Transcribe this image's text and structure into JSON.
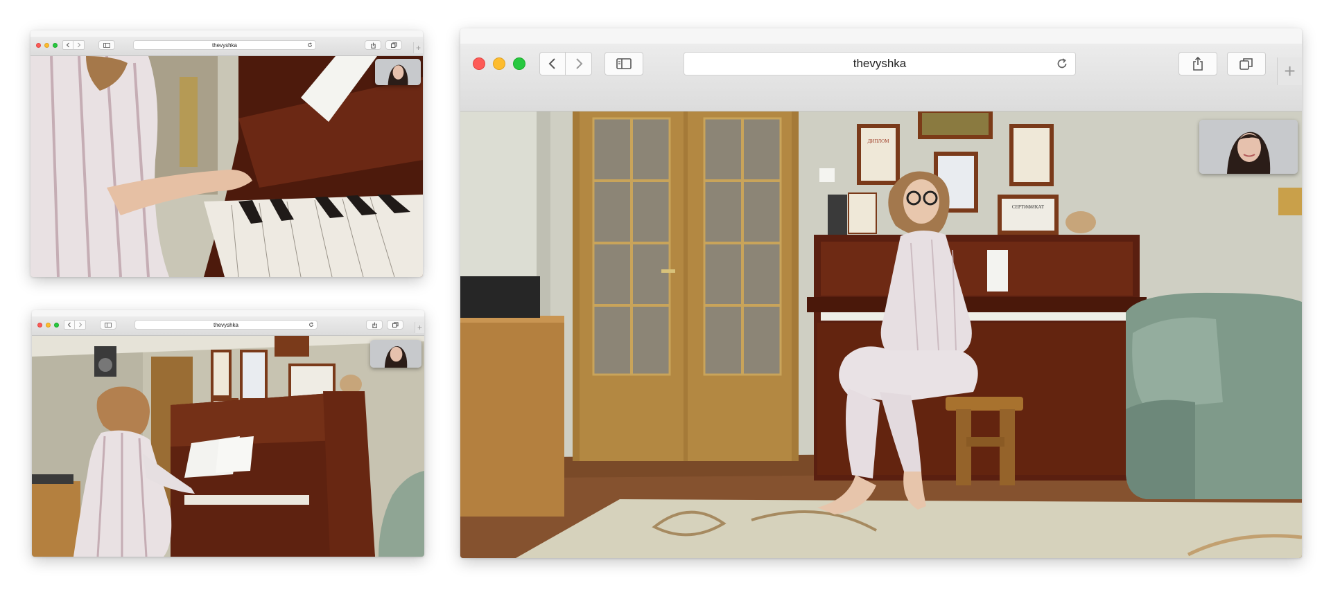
{
  "windows": [
    {
      "id": "main",
      "address": "thevyshka"
    },
    {
      "id": "top-left",
      "address": "thevyshka"
    },
    {
      "id": "bottom-left",
      "address": "thevyshka"
    }
  ],
  "scene": {
    "certificate_text": "СЕРТИФИКАТ",
    "diploma_text": "ДИПЛОМ"
  },
  "icons": {
    "back": "chevron-left-icon",
    "forward": "chevron-right-icon",
    "sidebar": "sidebar-icon",
    "reload": "reload-icon",
    "share": "share-icon",
    "tabs": "tabs-icon",
    "new_tab": "plus-icon"
  },
  "colors": {
    "close": "#fd5b57",
    "minimize": "#fdbc2e",
    "zoom": "#27c840",
    "toolbar": "#e4e4e4"
  }
}
